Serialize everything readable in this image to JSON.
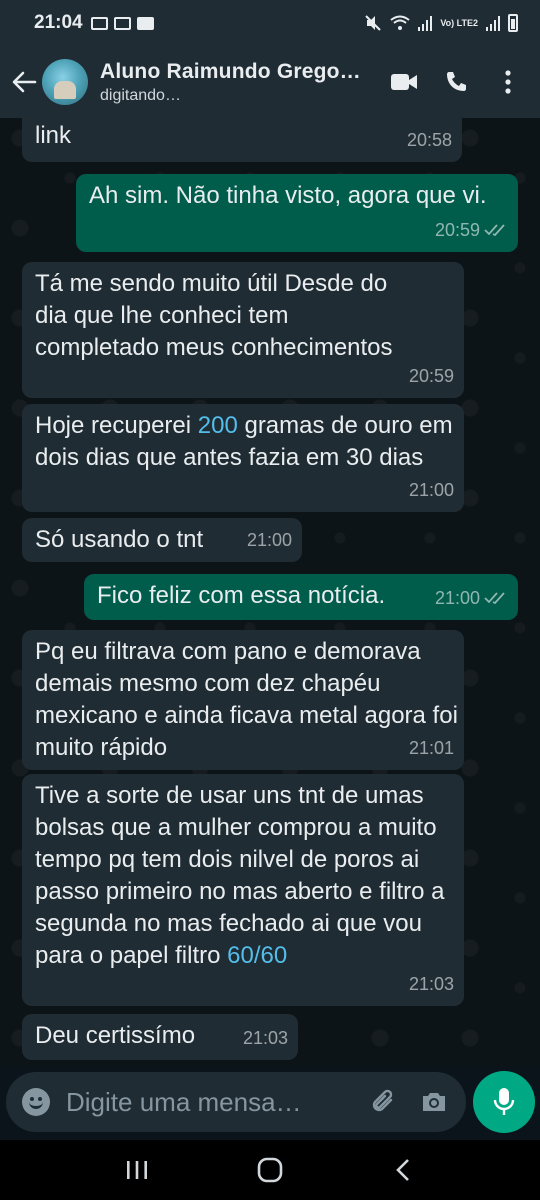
{
  "status_bar": {
    "time": "21:04",
    "network": "Vo) LTE2"
  },
  "header": {
    "contact_name": "Aluno Raimundo Grego…",
    "contact_status": "digitando…",
    "icons": [
      "back-arrow-icon",
      "video-call-icon",
      "voice-call-icon",
      "more-options-icon"
    ]
  },
  "messages": [
    {
      "direction": "in",
      "text": "link",
      "time": "20:58"
    },
    {
      "direction": "out",
      "text": "Ah sim. Não tinha visto, agora que vi.",
      "time": "20:59",
      "read": true
    },
    {
      "direction": "in",
      "text": "Tá me sendo muito útil Desde do dia que lhe conheci tem completado meus conhecimentos",
      "time": "20:59"
    },
    {
      "direction": "in",
      "text_before": "Hoje recuperei ",
      "link": "200",
      "text_after": " gramas de ouro em dois dias que antes fazia em 30 dias",
      "time": "21:00"
    },
    {
      "direction": "in",
      "text": "Só usando o tnt",
      "time": "21:00"
    },
    {
      "direction": "out",
      "text": "Fico feliz com essa notícia.",
      "time": "21:00",
      "read": true
    },
    {
      "direction": "in",
      "text": "Pq eu filtrava com pano e demorava demais mesmo com dez chapéu mexicano e ainda ficava metal agora foi muito rápido",
      "time": "21:01"
    },
    {
      "direction": "in",
      "text_before": "Tive a sorte de usar uns tnt de umas bolsas que a mulher comprou a muito tempo pq tem dois nilvel de poros ai passo primeiro no mas aberto e filtro a segunda no mas fechado ai que vou para o papel filtro ",
      "link": "60/60",
      "time": "21:03"
    },
    {
      "direction": "in",
      "text": "Deu certissímo",
      "time": "21:03"
    }
  ],
  "composer": {
    "placeholder": "Digite uma mensa…",
    "icons": [
      "emoji-icon",
      "attach-icon",
      "camera-icon",
      "mic-icon"
    ]
  },
  "nav": {
    "icons": [
      "recents-icon",
      "home-icon",
      "back-icon"
    ]
  },
  "colors": {
    "header_bg": "#1f2c34",
    "incoming_bubble": "#202c33",
    "outgoing_bubble": "#005c4b",
    "link": "#53bdeb",
    "mic_button": "#00a884"
  }
}
